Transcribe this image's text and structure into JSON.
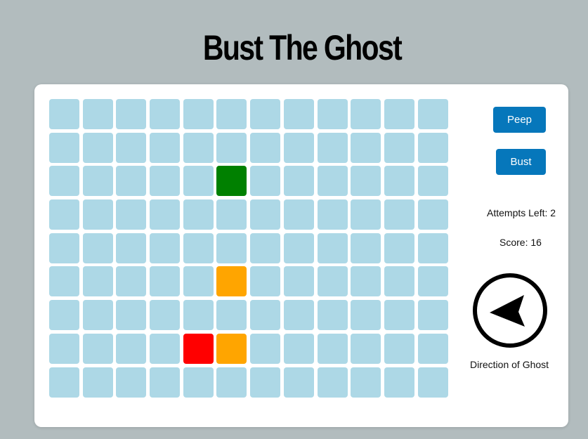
{
  "title": "Bust The Ghost",
  "controls": {
    "peep_label": "Peep",
    "bust_label": "Bust"
  },
  "status": {
    "attempts_label": "Attempts Left: 2",
    "score_label": "Score: 16",
    "direction_label": "Direction of Ghost"
  },
  "compass": {
    "icon": "arrow-icon",
    "direction": "west"
  },
  "board": {
    "rows": 9,
    "cols": 12,
    "default_color": "#add8e6",
    "colored_cells": [
      {
        "row": 2,
        "col": 5,
        "color": "#008000"
      },
      {
        "row": 5,
        "col": 5,
        "color": "#ffa500"
      },
      {
        "row": 7,
        "col": 4,
        "color": "#ff0000"
      },
      {
        "row": 7,
        "col": 5,
        "color": "#ffa500"
      }
    ]
  }
}
